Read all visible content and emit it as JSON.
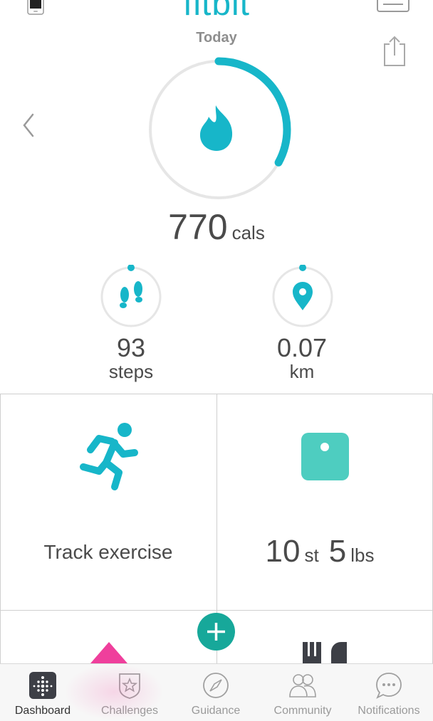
{
  "header": {
    "logo": "fitbit",
    "date_label": "Today"
  },
  "calories": {
    "value": "770",
    "unit": "cals",
    "goal_progress": 0.33
  },
  "steps": {
    "value": "93",
    "unit": "steps"
  },
  "distance": {
    "value": "0.07",
    "unit": "km"
  },
  "tiles": {
    "exercise_label": "Track exercise",
    "weight": {
      "stones": "10",
      "stone_unit": "st",
      "pounds": "5",
      "pound_unit": "lbs"
    }
  },
  "nav": {
    "items": [
      {
        "label": "Dashboard",
        "icon": "dashboard-icon"
      },
      {
        "label": "Challenges",
        "icon": "challenges-star-icon"
      },
      {
        "label": "Guidance",
        "icon": "compass-icon"
      },
      {
        "label": "Community",
        "icon": "community-icon"
      },
      {
        "label": "Notifications",
        "icon": "chat-bubble-icon"
      }
    ]
  },
  "colors": {
    "accent": "#17b6c9",
    "ring_track": "#e6e6e6",
    "scale_tile": "#4ecdc0",
    "add_button": "#17a89a",
    "pink": "#ef3f9c"
  }
}
